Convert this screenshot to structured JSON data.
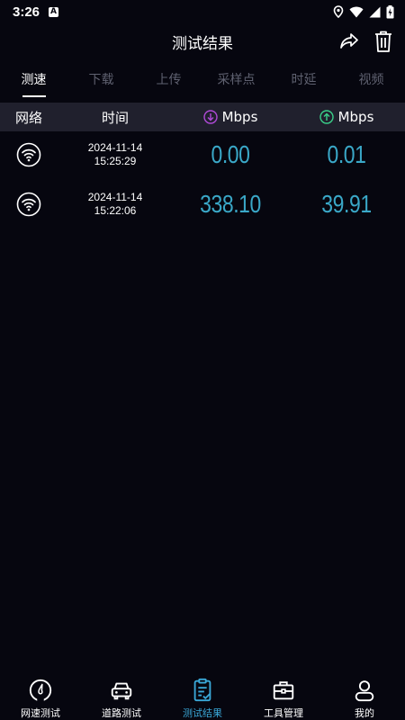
{
  "status_bar": {
    "time": "3:26"
  },
  "header": {
    "title": "测试结果"
  },
  "tabs": [
    {
      "label": "测速",
      "active": true
    },
    {
      "label": "下载",
      "active": false
    },
    {
      "label": "上传",
      "active": false
    },
    {
      "label": "采样点",
      "active": false
    },
    {
      "label": "时延",
      "active": false
    },
    {
      "label": "视频",
      "active": false
    }
  ],
  "table": {
    "headers": {
      "network": "网络",
      "time": "时间",
      "download_unit": "Mbps",
      "upload_unit": "Mbps"
    },
    "rows": [
      {
        "network": "wifi-icon",
        "date": "2024-11-14",
        "clock": "15:25:29",
        "download": "0.00",
        "upload": "0.01"
      },
      {
        "network": "wifi-icon",
        "date": "2024-11-14",
        "clock": "15:22:06",
        "download": "338.10",
        "upload": "39.91"
      }
    ]
  },
  "bottom_nav": [
    {
      "label": "网速测试",
      "icon": "speedometer-icon",
      "active": false
    },
    {
      "label": "道路测试",
      "icon": "car-icon",
      "active": false
    },
    {
      "label": "测试结果",
      "icon": "clipboard-icon",
      "active": true
    },
    {
      "label": "工具管理",
      "icon": "toolbox-icon",
      "active": false
    },
    {
      "label": "我的",
      "icon": "user-icon",
      "active": false
    }
  ],
  "colors": {
    "background": "#06060f",
    "accent": "#3aa8c8",
    "download_icon": "#b04ad8",
    "upload_icon": "#3ad08a",
    "header_row": "#20202d"
  }
}
